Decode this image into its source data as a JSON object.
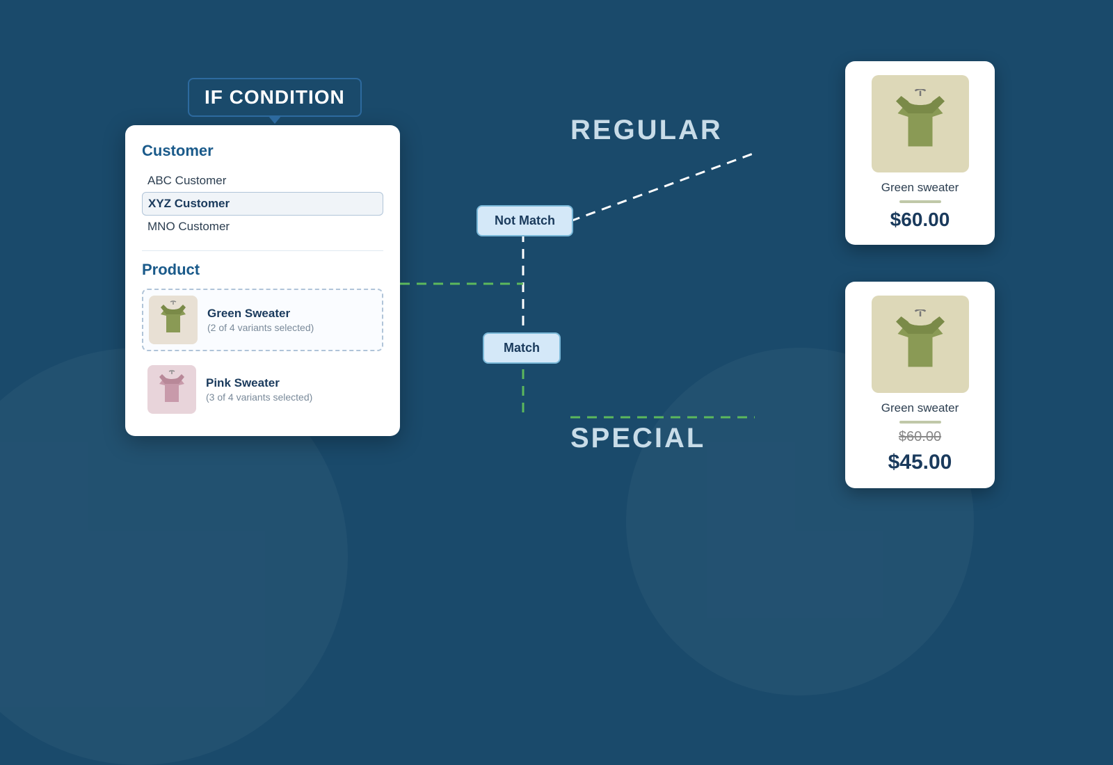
{
  "badge": {
    "label": "IF CONDITION"
  },
  "condition_card": {
    "customer_section_title": "Customer",
    "customers": [
      {
        "name": "ABC Customer",
        "selected": false
      },
      {
        "name": "XYZ Customer",
        "selected": true
      },
      {
        "name": "MNO Customer",
        "selected": false
      }
    ],
    "product_section_title": "Product",
    "products": [
      {
        "name": "Green Sweater",
        "variants": "(2 of 4 variants selected)",
        "color": "green",
        "selected": true
      },
      {
        "name": "Pink Sweater",
        "variants": "(3 of 4 variants selected)",
        "color": "pink",
        "selected": false
      }
    ]
  },
  "flow": {
    "not_match_label": "Not Match",
    "match_label": "Match",
    "regular_label": "REGULAR",
    "special_label": "SPECIAL"
  },
  "regular_card": {
    "product_name": "Green sweater",
    "price": "$60.00"
  },
  "special_card": {
    "product_name": "Green sweater",
    "original_price": "$60.00",
    "special_price": "$45.00"
  }
}
